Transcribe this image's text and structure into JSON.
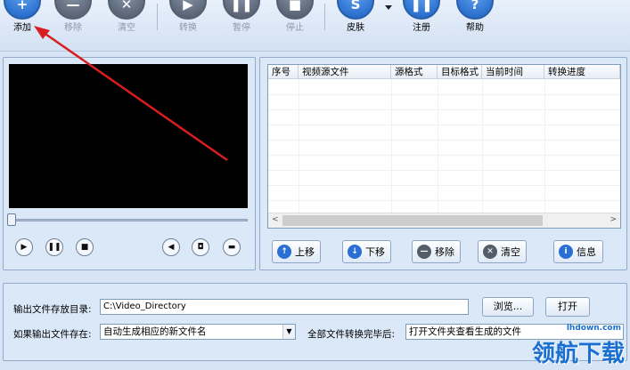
{
  "toolbar": {
    "buttons": [
      {
        "label": "添加",
        "icon": "plus-icon",
        "glyph": "+",
        "enabled": true
      },
      {
        "label": "移除",
        "icon": "minus-icon",
        "glyph": "—",
        "enabled": false
      },
      {
        "label": "清空",
        "icon": "clear-icon",
        "glyph": "✕",
        "enabled": false
      },
      {
        "label": "转换",
        "icon": "play-icon",
        "glyph": "▶",
        "enabled": false
      },
      {
        "label": "暂停",
        "icon": "pause-icon",
        "glyph": "❚❚",
        "enabled": false
      },
      {
        "label": "停止",
        "icon": "stop-icon",
        "glyph": "■",
        "enabled": false
      },
      {
        "label": "皮肤",
        "icon": "skin-icon",
        "glyph": "S",
        "enabled": true
      },
      {
        "label": "注册",
        "icon": "register-icon",
        "glyph": "❚❚",
        "enabled": true
      },
      {
        "label": "帮助",
        "icon": "help-icon",
        "glyph": "?",
        "enabled": true
      }
    ]
  },
  "player": {
    "play_glyph": "▶",
    "pause_glyph": "❚❚",
    "stop_glyph": "■",
    "volume_glyph": "◀",
    "snapshot_glyph": "◘",
    "folder_glyph": "▬",
    "seek_progress": 0
  },
  "file_list": {
    "columns": [
      "序号",
      "视频源文件",
      "源格式",
      "目标格式",
      "当前时间",
      "转换进度"
    ],
    "scroll_left": "<",
    "scroll_right": ">"
  },
  "actions": [
    {
      "label": "上移",
      "icon": "up-arrow-icon",
      "glyph": "↑",
      "color": "#2a6fd4"
    },
    {
      "label": "下移",
      "icon": "down-arrow-icon",
      "glyph": "↓",
      "color": "#2a6fd4"
    },
    {
      "label": "移除",
      "icon": "remove-icon",
      "glyph": "—",
      "color": "#555d68"
    },
    {
      "label": "清空",
      "icon": "clear-icon",
      "glyph": "✕",
      "color": "#555d68"
    },
    {
      "label": "信息",
      "icon": "info-icon",
      "glyph": "i",
      "color": "#2a6fd4"
    }
  ],
  "output": {
    "dir_label": "输出文件存放目录:",
    "dir_value": "C:\\Video_Directory",
    "browse_label": "浏览...",
    "open_label": "打开",
    "exists_label": "如果输出文件存在:",
    "exists_value": "自动生成相应的新文件名",
    "after_label": "全部文件转换完毕后:",
    "after_value": "打开文件夹查看生成的文件"
  },
  "watermark": {
    "text": "领航下载",
    "small": "lhdown.com"
  }
}
